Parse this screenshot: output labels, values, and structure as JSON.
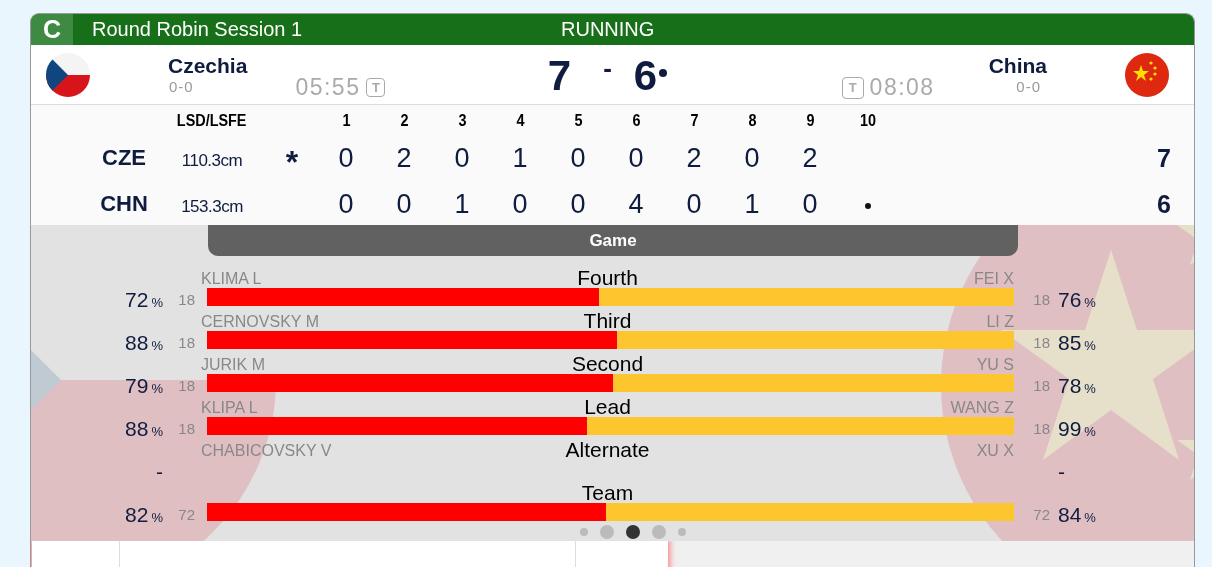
{
  "header": {
    "badge": "C",
    "title": "Round Robin Session 1",
    "status": "RUNNING"
  },
  "teams": [
    {
      "kind": "czech",
      "name": "Czechia",
      "record": "0-0",
      "clock": "05:55",
      "timeout": "T",
      "score": "7",
      "hammer": false
    },
    {
      "kind": "china",
      "name": "China",
      "record": "0-0",
      "clock": "08:08",
      "timeout": "T",
      "score": "6",
      "hammer": true
    }
  ],
  "score_separator": "-",
  "scoreboard": {
    "lsd_heading": "LSD/LSFE",
    "ends": [
      "1",
      "2",
      "3",
      "4",
      "5",
      "6",
      "7",
      "8",
      "9",
      "10"
    ],
    "rows": [
      {
        "code": "CZE",
        "lsd": "110.3cm",
        "marker": "*",
        "ends": [
          "0",
          "2",
          "0",
          "1",
          "0",
          "0",
          "2",
          "0",
          "2"
        ],
        "hammer": false,
        "total": "7"
      },
      {
        "code": "CHN",
        "lsd": "153.3cm",
        "ends": [
          "0",
          "0",
          "1",
          "0",
          "0",
          "4",
          "0",
          "1",
          "0"
        ],
        "hammer": true,
        "total": "6"
      }
    ]
  },
  "game": {
    "heading": "Game",
    "rows": [
      {
        "position": "Fourth",
        "left": {
          "name": "KLIMA L",
          "pct": "72",
          "unit": "%",
          "shots": "18"
        },
        "right": {
          "name": "FEI X",
          "pct": "76",
          "unit": "%",
          "shots": "18"
        },
        "level": 0.486
      },
      {
        "position": "Third",
        "left": {
          "name": "CERNOVSKY M",
          "pct": "88",
          "unit": "%",
          "shots": "18"
        },
        "right": {
          "name": "LI Z",
          "pct": "85",
          "unit": "%",
          "shots": "18"
        },
        "level": 0.508
      },
      {
        "position": "Second",
        "left": {
          "name": "JURIK M",
          "pct": "79",
          "unit": "%",
          "shots": "18"
        },
        "right": {
          "name": "YU S",
          "pct": "78",
          "unit": "%",
          "shots": "18"
        },
        "level": 0.503
      },
      {
        "position": "Lead",
        "left": {
          "name": "KLIPA L",
          "pct": "88",
          "unit": "%",
          "shots": "18"
        },
        "right": {
          "name": "WANG Z",
          "pct": "99",
          "unit": "%",
          "shots": "18"
        },
        "level": 0.471
      },
      {
        "position": "Alternate",
        "left": {
          "name": "CHABICOVSKY V",
          "pct": "-"
        },
        "right": {
          "name": "XU X",
          "pct": "-"
        }
      },
      {
        "position": "Team",
        "left": {
          "pct": "82",
          "unit": "%",
          "shots": "72"
        },
        "right": {
          "pct": "84",
          "unit": "%",
          "shots": "72"
        },
        "level": 0.494
      }
    ]
  },
  "pager": [
    {
      "selected": false
    },
    {
      "selected": false
    },
    {
      "selected": true
    },
    {
      "selected": false
    },
    {
      "selected": false
    }
  ]
}
